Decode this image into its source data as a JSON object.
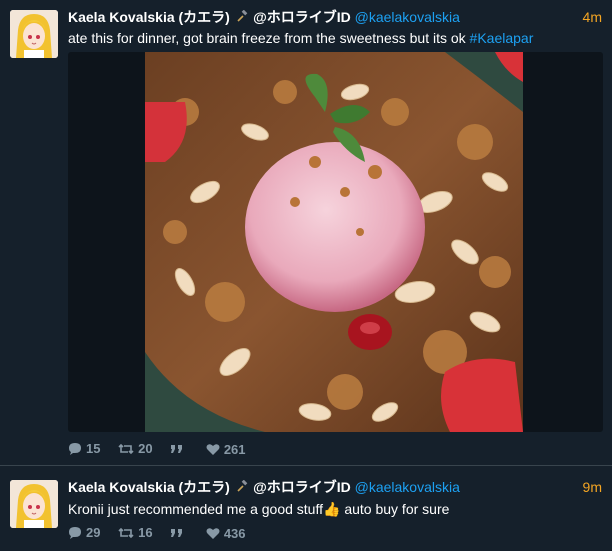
{
  "tweets": [
    {
      "display_name": "Kaela Kovalskia (カエラ)",
      "badge_icon": "hammer-icon",
      "group_handle": "@ホロライブID",
      "handle": "@kaelakovalskia",
      "time": "4m",
      "text": "ate this for dinner, got brain freeze from the sweetness but its ok ",
      "hashtag": "#Kaelapar",
      "replies": "15",
      "retweets": "20",
      "likes": "261"
    },
    {
      "display_name": "Kaela Kovalskia (カエラ)",
      "badge_icon": "hammer-icon",
      "group_handle": "@ホロライブID",
      "handle": "@kaelakovalskia",
      "time": "9m",
      "text": "Kronii just recommended me a good stuff",
      "emoji": "👍",
      "text_after": " auto buy for sure",
      "replies": "29",
      "retweets": "16",
      "likes": "436"
    }
  ],
  "colors": {
    "background": "#15202b",
    "link": "#1da1f2",
    "time": "#f5a623",
    "muted": "#8899a6"
  }
}
